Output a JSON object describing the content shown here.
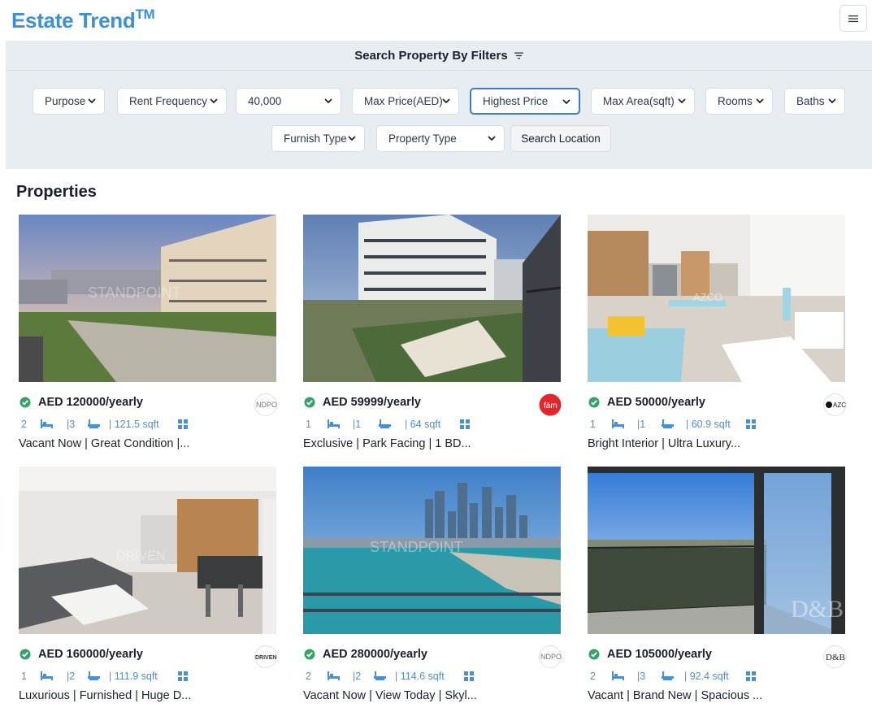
{
  "app": {
    "name": "Estate Trend",
    "trademark": "TM"
  },
  "filters": {
    "heading": "Search Property By Filters",
    "purpose": "Purpose",
    "rent_frequency": "Rent Frequency",
    "min_price": "40,000",
    "max_price": "Max Price(AED)",
    "sort": "Highest Price",
    "max_area": "Max Area(sqft)",
    "rooms": "Rooms",
    "baths": "Baths",
    "furnish_type": "Furnish Type",
    "property_type": "Property Type",
    "search_location": "Search Location"
  },
  "section_title": "Properties",
  "properties": [
    {
      "price": "AED 120000/yearly",
      "rooms": "2",
      "baths": "|3",
      "area": "| 121.5 sqft",
      "title": "Vacant Now | Great Condition |...",
      "agency_text": "NDPO",
      "watermark": "STANDPOINT"
    },
    {
      "price": "AED 59999/yearly",
      "rooms": "1",
      "baths": "|1",
      "area": "| 64 sqft",
      "title": "Exclusive | Park Facing | 1 BD...",
      "agency_text": "fäm",
      "watermark": ""
    },
    {
      "price": "AED 50000/yearly",
      "rooms": "1",
      "baths": "|1",
      "area": "| 60.9 sqft",
      "title": "Bright Interior | Ultra Luxury...",
      "agency_text": "AZC",
      "watermark": "AZCO"
    },
    {
      "price": "AED 160000/yearly",
      "rooms": "1",
      "baths": "|2",
      "area": "| 111.9 sqft",
      "title": "Luxurious | Furnished | Huge D...",
      "agency_text": "DRIVEN",
      "watermark": "DRIVEN"
    },
    {
      "price": "AED 280000/yearly",
      "rooms": "2",
      "baths": "|2",
      "area": "| 114.6 sqft",
      "title": "Vacant Now | View Today | Skyl...",
      "agency_text": "NDPO",
      "watermark": "STANDPOINT"
    },
    {
      "price": "AED 105000/yearly",
      "rooms": "2",
      "baths": "|3",
      "area": "| 92.4 sqft",
      "title": "Vacant | Brand New | Spacious ...",
      "agency_text": "D&B",
      "watermark": "D&B"
    }
  ],
  "colors": {
    "brand": "#3d8fd6",
    "accent_meta": "#4a90d0",
    "verified": "#38a169",
    "filter_bg": "#e8edf2"
  },
  "icons": [
    "menu-icon",
    "filter-icon",
    "chevron-down-icon",
    "verified-check-icon",
    "bed-icon",
    "bath-icon",
    "grid-icon"
  ]
}
